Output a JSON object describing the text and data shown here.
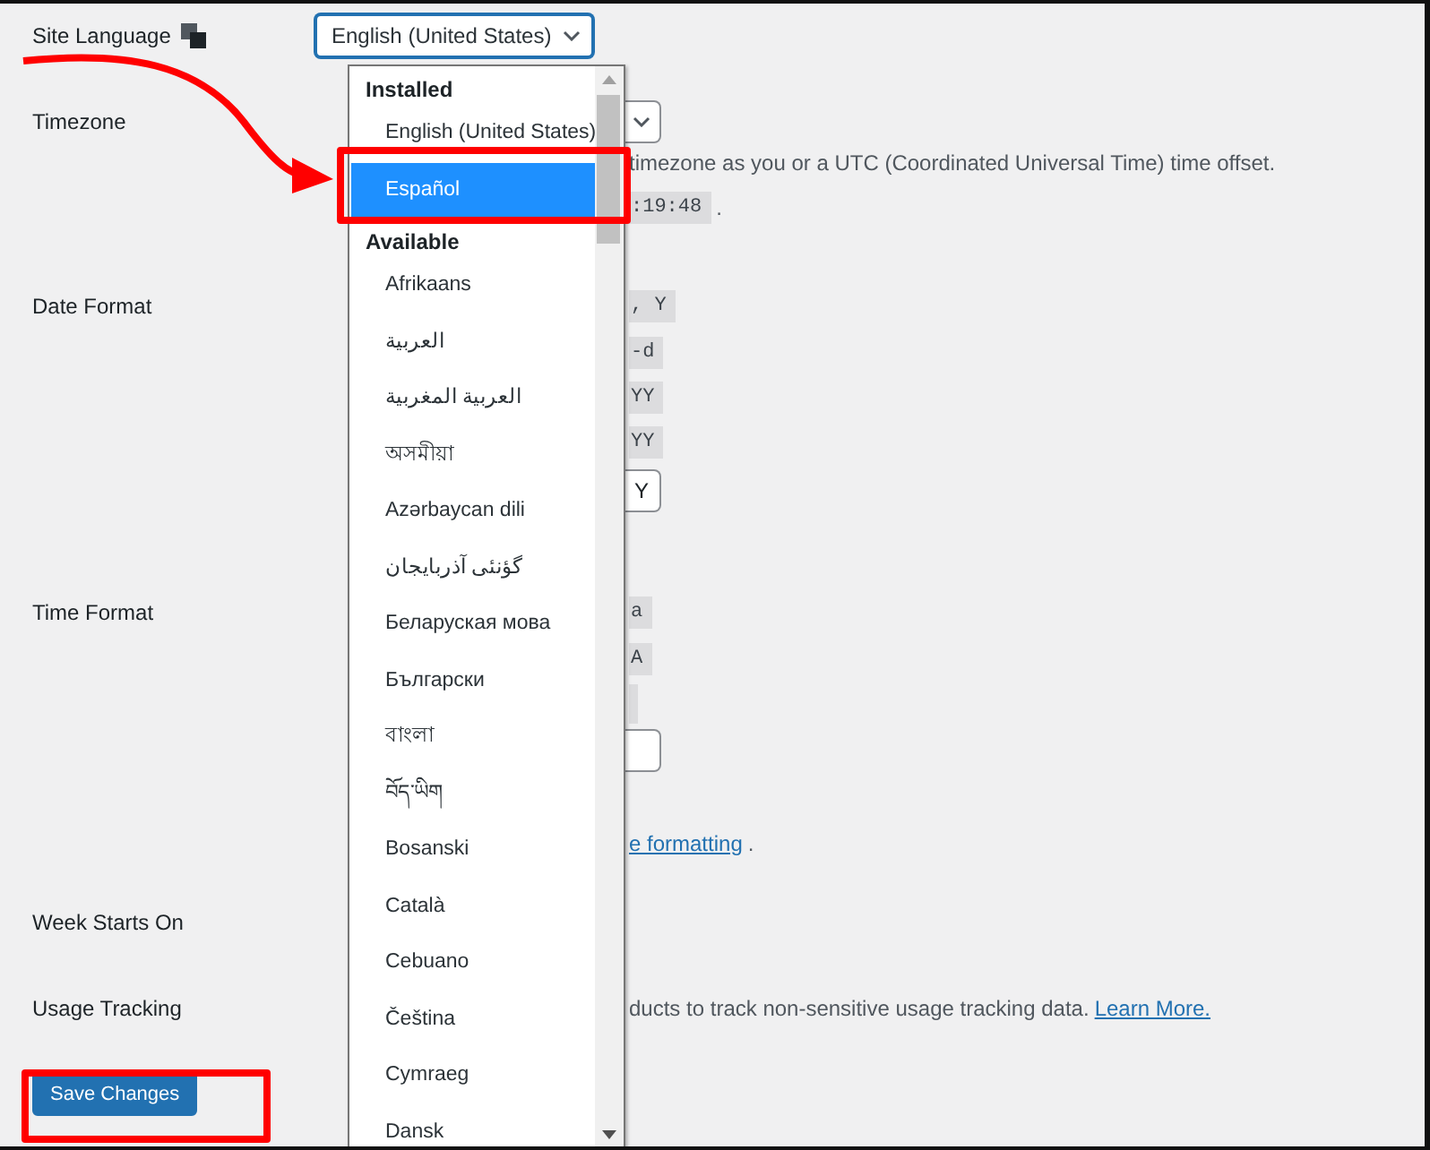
{
  "site_language": {
    "label": "Site Language",
    "value": "English (United States)"
  },
  "dropdown": {
    "groups": [
      {
        "heading": "Installed",
        "options": [
          {
            "label": "English (United States)",
            "selected": false
          },
          {
            "label": "Español",
            "selected": true
          }
        ]
      },
      {
        "heading": "Available",
        "options": [
          {
            "label": "Afrikaans",
            "selected": false
          },
          {
            "label": "العربية",
            "selected": false
          },
          {
            "label": "العربية المغربية",
            "selected": false
          },
          {
            "label": "অসমীয়া",
            "selected": false
          },
          {
            "label": "Azərbaycan dili",
            "selected": false
          },
          {
            "label": "گؤنئی آذربایجان",
            "selected": false
          },
          {
            "label": "Беларуская мова",
            "selected": false
          },
          {
            "label": "Български",
            "selected": false
          },
          {
            "label": "বাংলা",
            "selected": false
          },
          {
            "label": "བོད་ཡིག",
            "selected": false
          },
          {
            "label": "Bosanski",
            "selected": false
          },
          {
            "label": "Català",
            "selected": false
          },
          {
            "label": "Cebuano",
            "selected": false
          },
          {
            "label": "Čeština",
            "selected": false
          },
          {
            "label": "Cymraeg",
            "selected": false
          },
          {
            "label": "Dansk",
            "selected": false
          }
        ]
      }
    ]
  },
  "rows": [
    {
      "label": "Timezone",
      "lines": [
        [
          {
            "kind": "select"
          }
        ],
        [
          {
            "kind": "text",
            "text": "timezone as you or a UTC (Coordinated Universal Time) time offset."
          }
        ],
        [
          {
            "kind": "code",
            "text": ":19:48"
          },
          {
            "kind": "text",
            "text": "."
          }
        ]
      ]
    },
    {
      "label": "Date Format",
      "lines": [
        [
          {
            "kind": "code",
            "text": ", Y"
          }
        ],
        [
          {
            "kind": "code",
            "text": "-d"
          }
        ],
        [
          {
            "kind": "code",
            "text": "YY"
          }
        ],
        [
          {
            "kind": "code",
            "text": "YY"
          }
        ],
        [
          {
            "kind": "input",
            "text": "Y"
          }
        ]
      ]
    },
    {
      "label": "Time Format",
      "lines": [
        [
          {
            "kind": "code",
            "text": "a"
          }
        ],
        [
          {
            "kind": "code",
            "text": "A"
          }
        ],
        [
          {
            "kind": "chip"
          }
        ],
        [
          {
            "kind": "input"
          }
        ],
        [
          {
            "kind": "link",
            "text": "e formatting"
          },
          {
            "kind": "text",
            "text": "."
          }
        ]
      ]
    },
    {
      "label": "Week Starts On",
      "lines": []
    },
    {
      "label": "Usage Tracking",
      "lines": [
        [
          {
            "kind": "text",
            "text": "ducts to track non-sensitive usage tracking data."
          },
          {
            "kind": "link",
            "text": "Learn More."
          }
        ]
      ]
    }
  ],
  "save_button": "Save Changes"
}
